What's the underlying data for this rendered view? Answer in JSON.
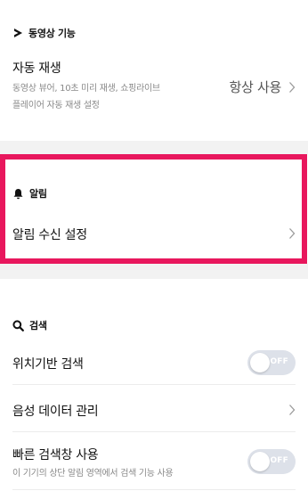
{
  "video": {
    "section_title": "동영상 기능",
    "icon": "play-triangle-icon",
    "autoplay": {
      "title": "자동 재생",
      "description_line1": "동영상 뷰어, 10초 미리 재생, 쇼핑라이브",
      "description_line2": "플레이어 자동 재생 설정",
      "value": "항상 사용"
    }
  },
  "alarm": {
    "section_title": "알림",
    "icon": "bell-icon",
    "receive_settings": {
      "title": "알림 수신 설정"
    }
  },
  "search": {
    "section_title": "검색",
    "icon": "search-icon",
    "location_search": {
      "title": "위치기반 검색",
      "toggle_label": "OFF",
      "on": false
    },
    "voice_data": {
      "title": "음성 데이터 관리"
    },
    "quick_search": {
      "title": "빠른 검색창 사용",
      "description": "이 기기의 상단 알림 영역에서 검색 기능 사용",
      "toggle_label": "OFF",
      "on": false
    }
  },
  "colors": {
    "highlight": "#e8175d",
    "toggle_off": "#dde1e9",
    "section_gap": "#f2f2f2"
  }
}
